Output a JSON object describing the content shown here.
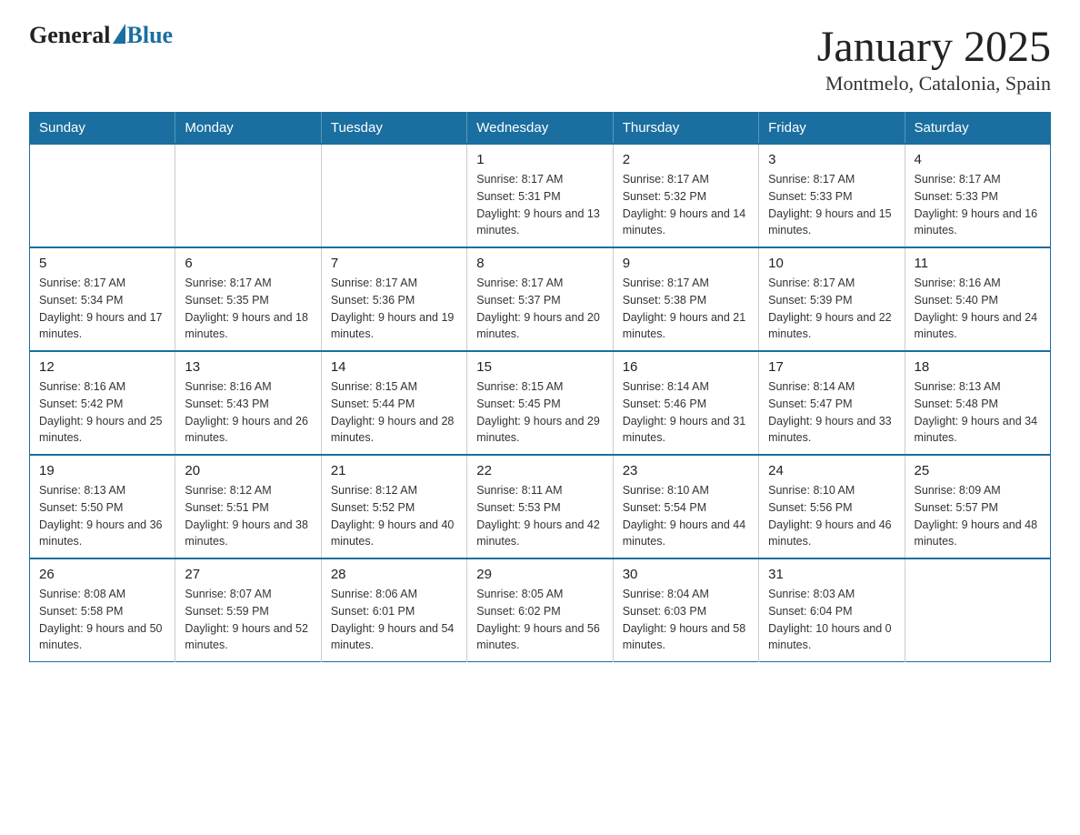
{
  "logo": {
    "text_general": "General",
    "text_blue": "Blue"
  },
  "title": "January 2025",
  "subtitle": "Montmelo, Catalonia, Spain",
  "headers": [
    "Sunday",
    "Monday",
    "Tuesday",
    "Wednesday",
    "Thursday",
    "Friday",
    "Saturday"
  ],
  "weeks": [
    [
      {
        "day": "",
        "info": ""
      },
      {
        "day": "",
        "info": ""
      },
      {
        "day": "",
        "info": ""
      },
      {
        "day": "1",
        "info": "Sunrise: 8:17 AM\nSunset: 5:31 PM\nDaylight: 9 hours\nand 13 minutes."
      },
      {
        "day": "2",
        "info": "Sunrise: 8:17 AM\nSunset: 5:32 PM\nDaylight: 9 hours\nand 14 minutes."
      },
      {
        "day": "3",
        "info": "Sunrise: 8:17 AM\nSunset: 5:33 PM\nDaylight: 9 hours\nand 15 minutes."
      },
      {
        "day": "4",
        "info": "Sunrise: 8:17 AM\nSunset: 5:33 PM\nDaylight: 9 hours\nand 16 minutes."
      }
    ],
    [
      {
        "day": "5",
        "info": "Sunrise: 8:17 AM\nSunset: 5:34 PM\nDaylight: 9 hours\nand 17 minutes."
      },
      {
        "day": "6",
        "info": "Sunrise: 8:17 AM\nSunset: 5:35 PM\nDaylight: 9 hours\nand 18 minutes."
      },
      {
        "day": "7",
        "info": "Sunrise: 8:17 AM\nSunset: 5:36 PM\nDaylight: 9 hours\nand 19 minutes."
      },
      {
        "day": "8",
        "info": "Sunrise: 8:17 AM\nSunset: 5:37 PM\nDaylight: 9 hours\nand 20 minutes."
      },
      {
        "day": "9",
        "info": "Sunrise: 8:17 AM\nSunset: 5:38 PM\nDaylight: 9 hours\nand 21 minutes."
      },
      {
        "day": "10",
        "info": "Sunrise: 8:17 AM\nSunset: 5:39 PM\nDaylight: 9 hours\nand 22 minutes."
      },
      {
        "day": "11",
        "info": "Sunrise: 8:16 AM\nSunset: 5:40 PM\nDaylight: 9 hours\nand 24 minutes."
      }
    ],
    [
      {
        "day": "12",
        "info": "Sunrise: 8:16 AM\nSunset: 5:42 PM\nDaylight: 9 hours\nand 25 minutes."
      },
      {
        "day": "13",
        "info": "Sunrise: 8:16 AM\nSunset: 5:43 PM\nDaylight: 9 hours\nand 26 minutes."
      },
      {
        "day": "14",
        "info": "Sunrise: 8:15 AM\nSunset: 5:44 PM\nDaylight: 9 hours\nand 28 minutes."
      },
      {
        "day": "15",
        "info": "Sunrise: 8:15 AM\nSunset: 5:45 PM\nDaylight: 9 hours\nand 29 minutes."
      },
      {
        "day": "16",
        "info": "Sunrise: 8:14 AM\nSunset: 5:46 PM\nDaylight: 9 hours\nand 31 minutes."
      },
      {
        "day": "17",
        "info": "Sunrise: 8:14 AM\nSunset: 5:47 PM\nDaylight: 9 hours\nand 33 minutes."
      },
      {
        "day": "18",
        "info": "Sunrise: 8:13 AM\nSunset: 5:48 PM\nDaylight: 9 hours\nand 34 minutes."
      }
    ],
    [
      {
        "day": "19",
        "info": "Sunrise: 8:13 AM\nSunset: 5:50 PM\nDaylight: 9 hours\nand 36 minutes."
      },
      {
        "day": "20",
        "info": "Sunrise: 8:12 AM\nSunset: 5:51 PM\nDaylight: 9 hours\nand 38 minutes."
      },
      {
        "day": "21",
        "info": "Sunrise: 8:12 AM\nSunset: 5:52 PM\nDaylight: 9 hours\nand 40 minutes."
      },
      {
        "day": "22",
        "info": "Sunrise: 8:11 AM\nSunset: 5:53 PM\nDaylight: 9 hours\nand 42 minutes."
      },
      {
        "day": "23",
        "info": "Sunrise: 8:10 AM\nSunset: 5:54 PM\nDaylight: 9 hours\nand 44 minutes."
      },
      {
        "day": "24",
        "info": "Sunrise: 8:10 AM\nSunset: 5:56 PM\nDaylight: 9 hours\nand 46 minutes."
      },
      {
        "day": "25",
        "info": "Sunrise: 8:09 AM\nSunset: 5:57 PM\nDaylight: 9 hours\nand 48 minutes."
      }
    ],
    [
      {
        "day": "26",
        "info": "Sunrise: 8:08 AM\nSunset: 5:58 PM\nDaylight: 9 hours\nand 50 minutes."
      },
      {
        "day": "27",
        "info": "Sunrise: 8:07 AM\nSunset: 5:59 PM\nDaylight: 9 hours\nand 52 minutes."
      },
      {
        "day": "28",
        "info": "Sunrise: 8:06 AM\nSunset: 6:01 PM\nDaylight: 9 hours\nand 54 minutes."
      },
      {
        "day": "29",
        "info": "Sunrise: 8:05 AM\nSunset: 6:02 PM\nDaylight: 9 hours\nand 56 minutes."
      },
      {
        "day": "30",
        "info": "Sunrise: 8:04 AM\nSunset: 6:03 PM\nDaylight: 9 hours\nand 58 minutes."
      },
      {
        "day": "31",
        "info": "Sunrise: 8:03 AM\nSunset: 6:04 PM\nDaylight: 10 hours\nand 0 minutes."
      },
      {
        "day": "",
        "info": ""
      }
    ]
  ]
}
